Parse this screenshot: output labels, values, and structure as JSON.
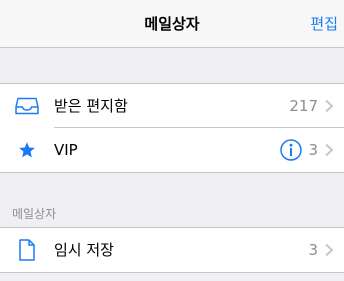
{
  "navbar": {
    "title": "메일상자",
    "edit_label": "편집"
  },
  "mailboxes": [
    {
      "label": "받은 편지함",
      "count": "217",
      "icon": "inbox-tray-icon"
    },
    {
      "label": "VIP",
      "count": "3",
      "icon": "star-icon",
      "info_icon": "info-circle-icon"
    }
  ],
  "section_header": "메일상자",
  "accounts": [
    {
      "label": "임시 저장",
      "count": "3",
      "icon": "document-icon"
    }
  ],
  "colors": {
    "accent": "#1a7cf4",
    "secondary_text": "#8e8e93",
    "background": "#efeff4"
  }
}
